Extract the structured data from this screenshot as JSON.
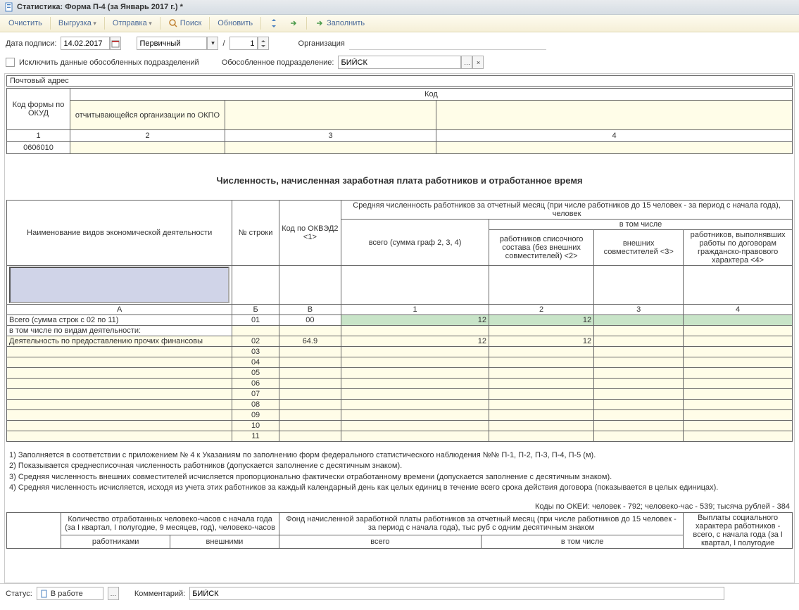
{
  "window": {
    "title": "Статистика: Форма П-4 (за Январь 2017 г.) *"
  },
  "toolbar": {
    "clear": "Очистить",
    "export": "Выгрузка",
    "send": "Отправка",
    "search": "Поиск",
    "refresh": "Обновить",
    "fill": "Заполнить"
  },
  "params": {
    "sign_date_label": "Дата подписи:",
    "sign_date": "14.02.2017",
    "doc_type": "Первичный",
    "slash": "/",
    "num": "1",
    "org_label": "Организация",
    "org_value": "",
    "exclude_label": "Исключить данные обособленных подразделений",
    "subdiv_label": "Обособленное подразделение:",
    "subdiv_value": "БИЙСК"
  },
  "codes_table": {
    "postal_label": "Почтовый адрес",
    "code_label": "Код",
    "col0": "Код формы по ОКУД",
    "col1": "отчитывающейся организации по ОКПО",
    "num1": "1",
    "num2": "2",
    "num3": "3",
    "num4": "4",
    "okud": "0606010"
  },
  "form_title": "Численность, начисленная заработная плата работников и отработанное время",
  "grid1": {
    "h_activity": "Наименование видов экономической деятельности",
    "h_row": "№ строки",
    "h_okved": "Код по ОКВЭД2 <1>",
    "h_avg": "Средняя численность работников за отчетный месяц (при числе работников до 15 человек - за период с начала года), человек",
    "h_total": "всего (сумма граф 2, 3, 4)",
    "h_incl": "в том числе",
    "h_emp": "работников списочного состава (без внешних совместителей) <2>",
    "h_ext": "внешних совместителей <3>",
    "h_contract": "работников, выполнявших работы по договорам гражданско-правового характера <4>",
    "colA": "А",
    "colB": "Б",
    "colV": "В",
    "col1": "1",
    "col2": "2",
    "col3": "3",
    "col4": "4",
    "rows": [
      {
        "name": "Всего (сумма строк с 02 по 11)",
        "num": "01",
        "okved": "00",
        "c1": "12",
        "c2": "12",
        "c3": "",
        "c4": "",
        "kind": "total"
      },
      {
        "name": "  в том числе по видам деятельности:",
        "num": "",
        "okved": "",
        "c1": "",
        "c2": "",
        "c3": "",
        "c4": "",
        "kind": "sub"
      },
      {
        "name": "Деятельность по предоставлению прочих финансовы",
        "num": "02",
        "okved": "64.9",
        "c1": "12",
        "c2": "12",
        "c3": "",
        "c4": "",
        "kind": "data"
      },
      {
        "name": "",
        "num": "03",
        "okved": "",
        "c1": "",
        "c2": "",
        "c3": "",
        "c4": "",
        "kind": "data"
      },
      {
        "name": "",
        "num": "04",
        "okved": "",
        "c1": "",
        "c2": "",
        "c3": "",
        "c4": "",
        "kind": "data"
      },
      {
        "name": "",
        "num": "05",
        "okved": "",
        "c1": "",
        "c2": "",
        "c3": "",
        "c4": "",
        "kind": "data"
      },
      {
        "name": "",
        "num": "06",
        "okved": "",
        "c1": "",
        "c2": "",
        "c3": "",
        "c4": "",
        "kind": "data"
      },
      {
        "name": "",
        "num": "07",
        "okved": "",
        "c1": "",
        "c2": "",
        "c3": "",
        "c4": "",
        "kind": "data"
      },
      {
        "name": "",
        "num": "08",
        "okved": "",
        "c1": "",
        "c2": "",
        "c3": "",
        "c4": "",
        "kind": "data"
      },
      {
        "name": "",
        "num": "09",
        "okved": "",
        "c1": "",
        "c2": "",
        "c3": "",
        "c4": "",
        "kind": "data"
      },
      {
        "name": "",
        "num": "10",
        "okved": "",
        "c1": "",
        "c2": "",
        "c3": "",
        "c4": "",
        "kind": "data"
      },
      {
        "name": "",
        "num": "11",
        "okved": "",
        "c1": "",
        "c2": "",
        "c3": "",
        "c4": "",
        "kind": "data"
      }
    ]
  },
  "footnotes": {
    "n1": "1)  Заполняется в соответствии с приложением № 4 к Указаниям по заполнению форм федерального статистического наблюдения №№ П-1, П-2, П-3, П-4, П-5 (м).",
    "n2": "2)  Показывается среднесписочная численность работников (допускается заполнение с десятичным знаком).",
    "n3": "3)  Средняя численность внешних совместителей исчисляется пропорционально фактически отработанному времени (допускается заполнение с десятичным знаком).",
    "n4": "4)  Средняя численность исчисляется, исходя из учета этих работников за каждый календарный день как целых единиц в течение всего срока действия договора (показывается в целых единицах)."
  },
  "okei": "Коды по ОКЕИ: человек - 792; человеко-час - 539; тысяча рублей - 384",
  "grid2": {
    "h_hours": "Количество отработанных человеко-часов с начала  года (за I квартал, I полугодие, 9 месяцев, год), человеко-часов",
    "h_fund": "Фонд начисленной заработной платы работников за отчетный месяц (при числе работников до 15 человек - за период с начала года), тыс руб с одним десятичным знаком",
    "h_social": "Выплаты социального характера работников - всего,  с начала года (за I квартал, I полугодие",
    "sh1": "работниками",
    "sh2": "внешними",
    "sh3": "всего",
    "sh4": "в том числе"
  },
  "status": {
    "label": "Статус:",
    "value": "В работе",
    "comment_label": "Комментарий:",
    "comment_value": "БИЙСК"
  }
}
